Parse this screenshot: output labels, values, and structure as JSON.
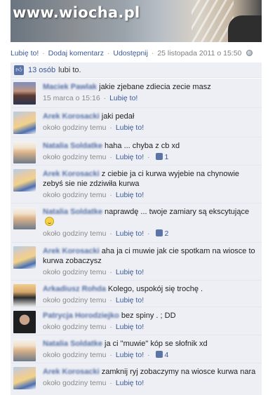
{
  "photo": {
    "watermark": "www.wiocha.pl"
  },
  "actions": {
    "like": "Lubię to!",
    "comment": "Dodaj komentarz",
    "share": "Udostępnij",
    "timestamp": "25 listopada 2011 o 15:50",
    "separator": "·"
  },
  "likes_bar": {
    "count": "13 osób",
    "suffix": "lubi to."
  },
  "comments": [
    {
      "author": "Maciek Pawlak",
      "text": "jakie zjebane zdiecia zecie masz",
      "time": "15 marca o 15:16",
      "like": "Lubię to!",
      "likes": ""
    },
    {
      "author": "Arek Korosacki",
      "text": "jaki pedał",
      "time": "około godziny temu",
      "like": "Lubię to!",
      "likes": ""
    },
    {
      "author": "Natalia Soldatke",
      "text": "haha ... chyba z cb xd",
      "time": "około godziny temu",
      "like": "Lubię to!",
      "likes": "1"
    },
    {
      "author": "Arek Korosacki",
      "text": "z ciebie ja ci kurwa wyjebie na chynowie zebyś sie nie zdziwiła kurwa",
      "time": "około godziny temu",
      "like": "Lubię to!",
      "likes": ""
    },
    {
      "author": "Natalia Soldatke",
      "text": "naprawdę ... twoje zamiary są ekscytujące",
      "time": "około godziny temu",
      "like": "Lubię to!",
      "likes": "2"
    },
    {
      "author": "Arek Korosacki",
      "text": "aha ja ci muwie jak cie spotkam na wiosce to kurwa zobaczysz",
      "time": "około godziny temu",
      "like": "Lubię to!",
      "likes": ""
    },
    {
      "author": "Arkadiusz Rohda",
      "text": "Kolego, uspokój się trochę .",
      "time": "około godziny temu",
      "like": "Lubię to!",
      "likes": ""
    },
    {
      "author": "Patrycja Horodziejko",
      "text": "bez spiny . ; DD",
      "time": "około godziny temu",
      "like": "Lubię to!",
      "likes": ""
    },
    {
      "author": "Natalia Soldatke",
      "text": "ja ci \"muwie\" kóp se słofnik xd",
      "time": "około godziny temu",
      "like": "Lubię to!",
      "likes": "4"
    },
    {
      "author": "Arek Korosacki",
      "text": "zamknij ryj zobaczymy na wiosce kurwa nara",
      "time": "około godziny temu",
      "like": "Lubię to!",
      "likes": ""
    }
  ]
}
